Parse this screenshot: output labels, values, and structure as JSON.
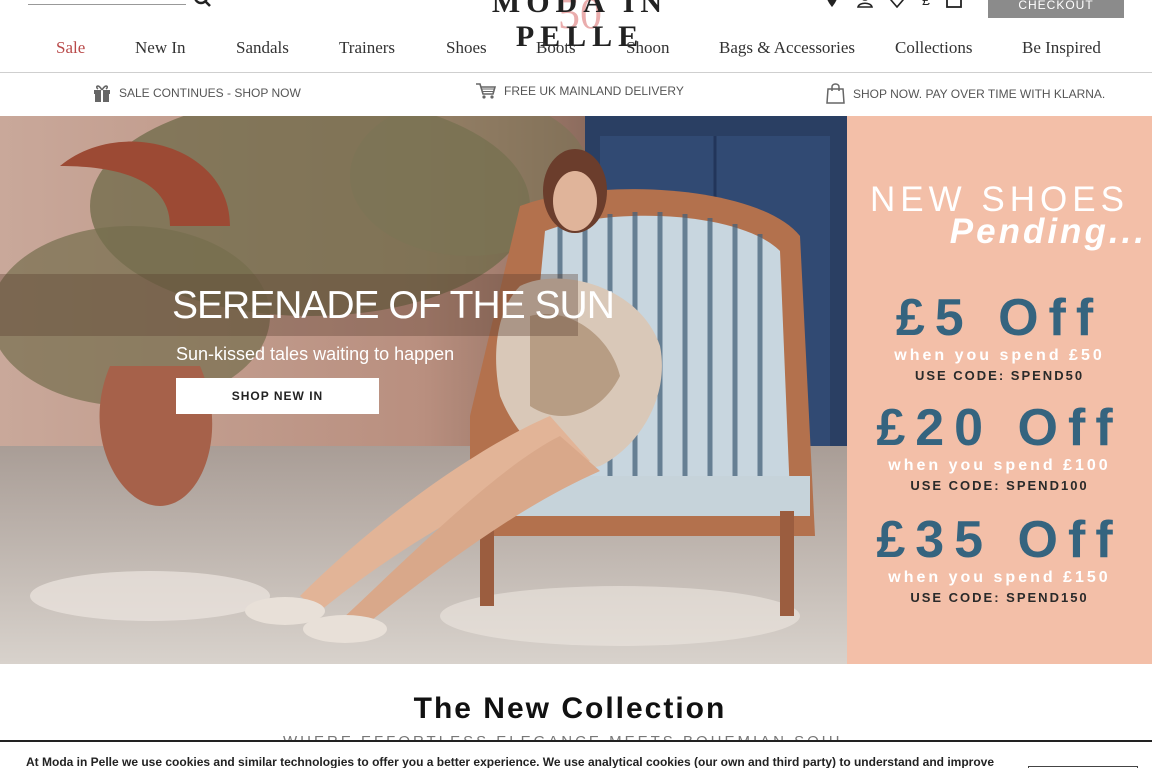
{
  "header": {
    "search_icon": "search-icon",
    "logo_text": "MODA IN PELLE",
    "logo_number": "50",
    "icons": [
      "location-pin-icon",
      "account-icon",
      "wishlist-heart-icon",
      "currency-pound-icon",
      "bag-icon"
    ],
    "currency_symbol": "£",
    "checkout_label": "CHECKOUT"
  },
  "nav": {
    "items": [
      "Sale",
      "New In",
      "Sandals",
      "Trainers",
      "Shoes",
      "Boots",
      "Shoon",
      "Bags & Accessories",
      "Collections",
      "Be Inspired"
    ]
  },
  "usp": {
    "items": [
      {
        "icon": "gift-icon",
        "label": "SALE CONTINUES - SHOP NOW"
      },
      {
        "icon": "cart-icon",
        "label": "FREE UK MAINLAND DELIVERY"
      },
      {
        "icon": "shopping-bag-icon",
        "label": "SHOP NOW. PAY OVER TIME WITH KLARNA."
      }
    ]
  },
  "hero": {
    "title": "SERENADE OF THE SUN",
    "subtitle": "Sun-kissed tales waiting to happen",
    "button_label": "SHOP NEW IN"
  },
  "promo": {
    "heading": "NEW SHOES",
    "heading2": "Pending...",
    "offers": [
      {
        "amount": "£5 Off",
        "condition": "when you spend £50",
        "code": "USE CODE: SPEND50"
      },
      {
        "amount": "£20 Off",
        "condition": "when you spend £100",
        "code": "USE CODE: SPEND100"
      },
      {
        "amount": "£35 Off",
        "condition": "when you spend £150",
        "code": "USE CODE: SPEND150"
      }
    ],
    "colors": {
      "background": "#f3bfa8",
      "amount": "#35647f"
    }
  },
  "collection": {
    "title": "The New Collection",
    "subtitle": "WHERE EFFORTLESS ELEGANCE MEETS BOHEMIAN SOUL"
  },
  "cookie": {
    "text": "At Moda in Pelle we use cookies and similar technologies to offer you a better experience. We use analytical cookies (our own and third party) to understand and improve"
  }
}
